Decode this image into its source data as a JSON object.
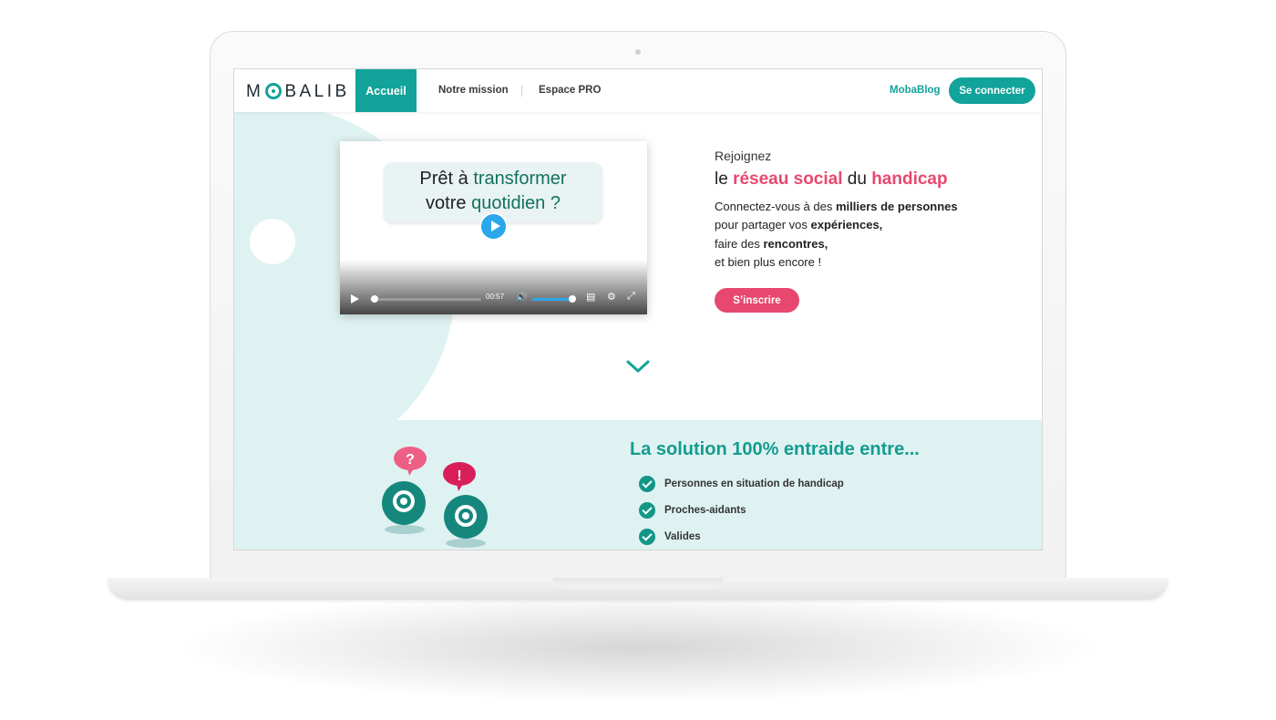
{
  "nav": {
    "logo": "MOBALIB",
    "active_item": "Accueil",
    "items": [
      "Notre mission",
      "Espace PRO"
    ],
    "blog": "MobaBlog",
    "login": "Se connecter"
  },
  "video": {
    "line1_a": "Prêt à ",
    "line1_b": "transformer",
    "line2_a": "votre ",
    "line2_b": "quotidien ?",
    "time": "00:57",
    "progress_fraction": 0.04,
    "volume_fraction": 1.0
  },
  "hero": {
    "join": "Rejoignez",
    "head_1": "le ",
    "head_2": "réseau social",
    "head_3": " du ",
    "head_4": "handicap",
    "body_1a": "Connectez-vous à des ",
    "body_1b": "milliers de personnes",
    "body_2a": "pour partager vos ",
    "body_2b": "expériences,",
    "body_3a": "faire des ",
    "body_3b": "rencontres,",
    "body_4": "et bien plus encore !",
    "signup": "S’inscrire"
  },
  "solution": {
    "title": "La solution 100% entraide entre...",
    "items": [
      "Personnes en situation de handicap",
      "Proches-aidants",
      "Valides"
    ],
    "bubble_question": "?",
    "bubble_exclaim": "!"
  },
  "colors": {
    "teal": "#12a39a",
    "pink": "#e8486f",
    "light_teal": "#dff2f2"
  },
  "icons": [
    "play-icon",
    "volume-icon",
    "subtitles-icon",
    "settings-icon",
    "fullscreen-icon",
    "chevron-down-icon",
    "check-icon"
  ]
}
